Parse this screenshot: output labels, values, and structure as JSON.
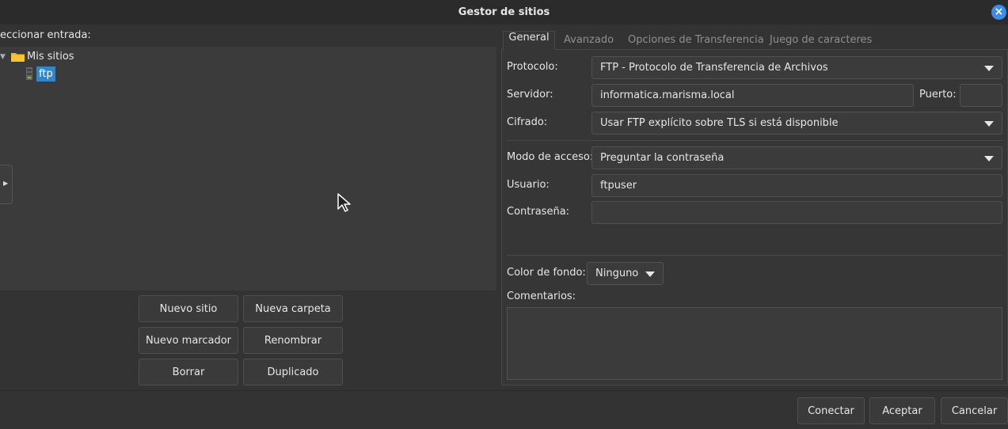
{
  "window": {
    "title": "Gestor de sitios",
    "close_icon": "close-icon",
    "accent": "#3a8ee6"
  },
  "left": {
    "select_label": "eccionar entrada:",
    "tree": {
      "root_label": "Mis sitios",
      "child_label": "ftp",
      "selected_color": "#2f86c8"
    },
    "buttons": {
      "new_site": "Nuevo sitio",
      "new_folder": "Nueva carpeta",
      "new_bookmark": "Nuevo marcador",
      "rename": "Renombrar",
      "delete": "Borrar",
      "duplicate": "Duplicado"
    }
  },
  "tabs": [
    "General",
    "Avanzado",
    "Opciones de Transferencia",
    "Juego de caracteres"
  ],
  "general": {
    "protocol_label": "Protocolo:",
    "protocol_value": "FTP - Protocolo de Transferencia de Archivos",
    "server_label": "Servidor:",
    "server_value": "informatica.marisma.local",
    "port_label": "Puerto:",
    "port_value": "",
    "encryption_label": "Cifrado:",
    "encryption_value": "Usar FTP explícito sobre TLS si está disponible",
    "logon_label": "Modo de acceso:",
    "logon_value": "Preguntar la contraseña",
    "user_label": "Usuario:",
    "user_value": "ftpuser",
    "password_label": "Contraseña:",
    "password_value": "",
    "bgcolor_label": "Color de fondo:",
    "bgcolor_value": "Ninguno",
    "comments_label": "Comentarios:",
    "comments_value": ""
  },
  "footer": {
    "connect": "Conectar",
    "ok": "Aceptar",
    "cancel": "Cancelar"
  }
}
